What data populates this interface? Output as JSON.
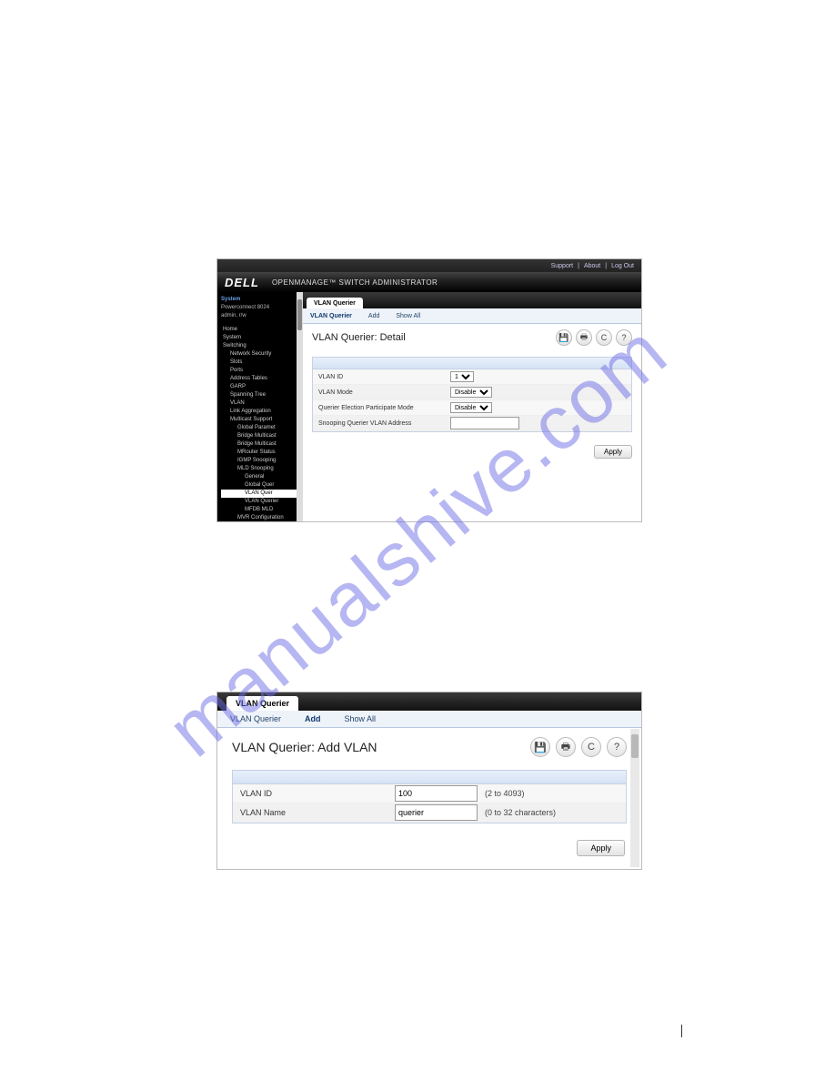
{
  "watermark": "manualshive.com",
  "s1": {
    "toplinks": [
      "Support",
      "About",
      "Log Out"
    ],
    "logo": "DELL",
    "app_title": "OPENMANAGE™ SWITCH ADMINISTRATOR",
    "sidebar": {
      "heading": "System",
      "model": "Powerconnect 8024",
      "user": "admin, r/w",
      "tree": [
        "Home",
        "System",
        "Switching",
        "Network Security",
        "Slots",
        "Ports",
        "Address Tables",
        "GARP",
        "Spanning Tree",
        "VLAN",
        "Link Aggregation",
        "Multicast Support",
        "Global Paramet",
        "Bridge Multicast",
        "Bridge Multicast",
        "MRouter Status",
        "IGMP Snooping",
        "MLD Snooping",
        "General",
        "Global Quer",
        "VLAN Quer",
        "VLAN Querier",
        "MFDB MLD",
        "MVR Configuration"
      ]
    },
    "tab": "VLAN Querier",
    "subtabs": [
      "VLAN Querier",
      "Add",
      "Show All"
    ],
    "page_title": "VLAN Querier: Detail",
    "form": [
      {
        "label": "VLAN ID",
        "value": "1"
      },
      {
        "label": "VLAN Mode",
        "value": "Disable"
      },
      {
        "label": "Querier Election Participate Mode",
        "value": "Disable"
      },
      {
        "label": "Snooping Querier VLAN Address",
        "value": ""
      }
    ],
    "apply": "Apply"
  },
  "s2": {
    "tab": "VLAN Querier",
    "subtabs": [
      "VLAN Querier",
      "Add",
      "Show All"
    ],
    "page_title": "VLAN Querier: Add VLAN",
    "form": [
      {
        "label": "VLAN ID",
        "value": "100",
        "hint": "(2 to 4093)"
      },
      {
        "label": "VLAN Name",
        "value": "querier",
        "hint": "(0 to 32 characters)"
      }
    ],
    "apply": "Apply"
  }
}
